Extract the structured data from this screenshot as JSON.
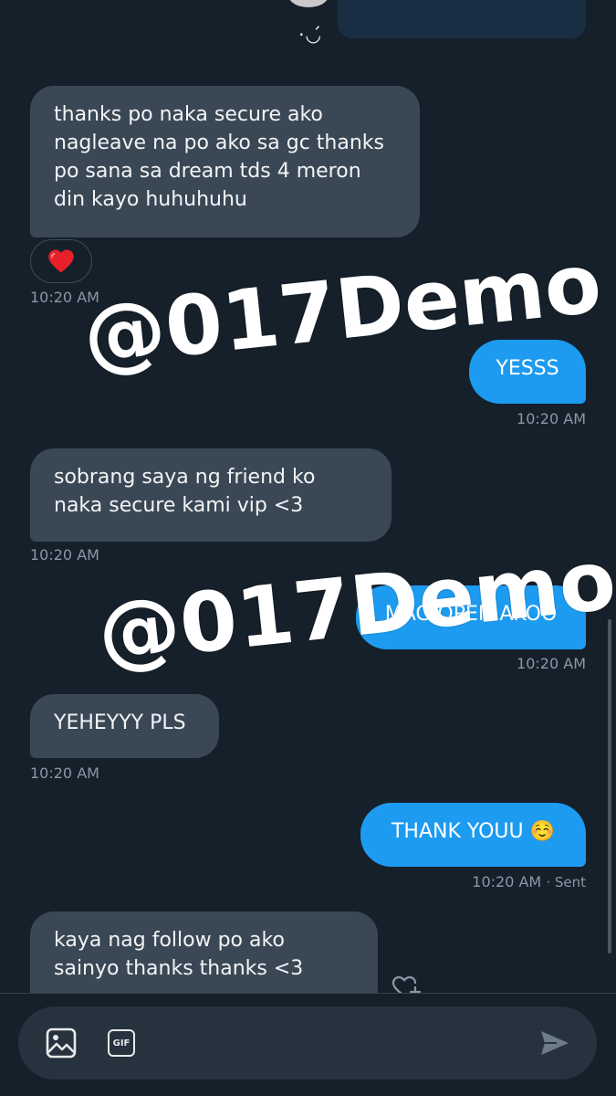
{
  "conversation": {
    "top_emoticon": "·◡́",
    "messages": [
      {
        "id": "m1",
        "direction": "received",
        "text": "thanks po naka secure ako nagleave na po ako sa gc thanks po sana sa dream tds 4 meron din kayo huhuhuhu",
        "reaction": "❤️",
        "time": "10:20 AM"
      },
      {
        "id": "m2",
        "direction": "sent",
        "text": "YESSS",
        "time": "10:20 AM"
      },
      {
        "id": "m3",
        "direction": "received",
        "text": "sobrang saya ng friend ko naka secure kami vip <3",
        "time": "10:20 AM"
      },
      {
        "id": "m4",
        "direction": "sent",
        "text": "MAG OPEN AKOO",
        "time": "10:20 AM"
      },
      {
        "id": "m5",
        "direction": "received",
        "text": "YEHEYYY PLS",
        "time": "10:20 AM"
      },
      {
        "id": "m6",
        "direction": "sent",
        "text": "THANK YOUU ☺️",
        "time": "10:20 AM",
        "status": "· Sent"
      },
      {
        "id": "m7",
        "direction": "received",
        "text": "kaya nag follow po ako sainyo thanks thanks <3"
      }
    ]
  },
  "watermark": {
    "text": "@017Demo"
  },
  "composer": {
    "icons": [
      "image-icon",
      "gif-icon",
      "send-icon"
    ],
    "gif_label": "GIF"
  },
  "colors": {
    "background": "#15202b",
    "received_bubble": "#3a4856",
    "sent_bubble": "#1d9bf0",
    "timestamp": "#8b98a5"
  }
}
